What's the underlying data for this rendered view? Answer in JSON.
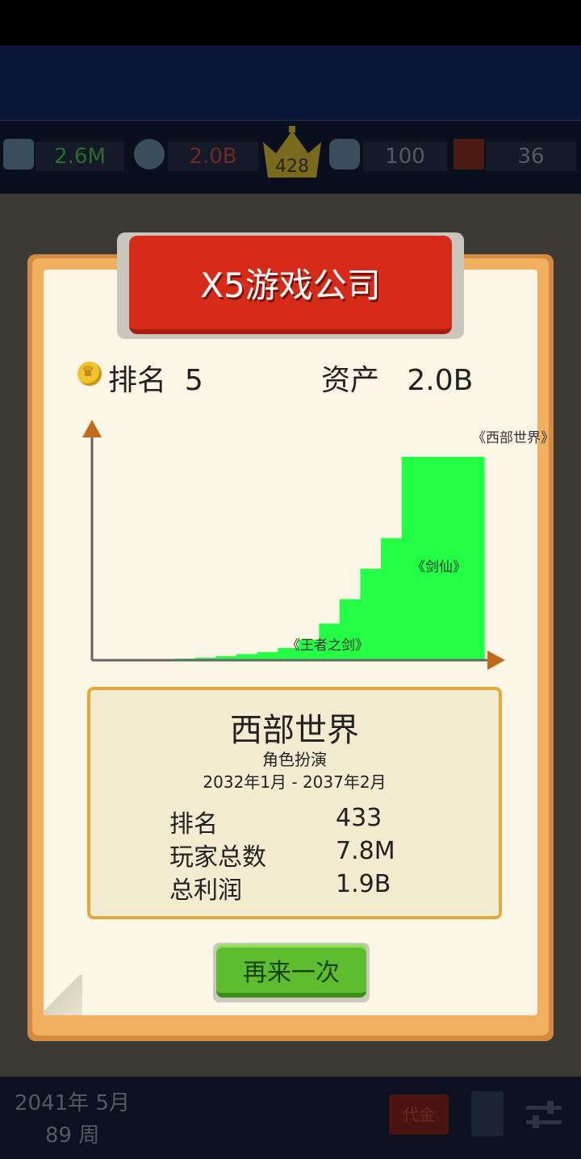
{
  "header_stats": {
    "fans": "2.6M",
    "money": "2.0B",
    "crown_rank": "428",
    "staff": "100",
    "slot": "36"
  },
  "dialog": {
    "title": "X5游戏公司",
    "rank_label": "排名",
    "rank_value": "5",
    "assets_label": "资产",
    "assets_value": "2.0B"
  },
  "chart_data": {
    "type": "area",
    "title": "",
    "xlabel": "",
    "ylabel": "",
    "annotations": [
      "《王者之剑》",
      "《剑仙》",
      "《西部世界》"
    ],
    "series": [
      {
        "values": [
          0.1,
          0.2,
          0.4,
          0.6,
          0.8,
          1.2,
          2,
          3,
          4,
          6,
          10,
          18,
          30,
          45,
          60,
          100,
          100,
          100,
          100
        ]
      }
    ],
    "colors": {
      "fill": "#22ff44",
      "axis": "#666666",
      "arrow": "#c06a1e"
    }
  },
  "info": {
    "name": "西部世界",
    "genre": "角色扮演",
    "period": "2032年1月 - 2037年2月",
    "rows": [
      {
        "label": "排名",
        "value": "433"
      },
      {
        "label": "玩家总数",
        "value": "7.8M"
      },
      {
        "label": "总利润",
        "value": "1.9B"
      }
    ]
  },
  "button": {
    "label": "再来一次"
  },
  "footer": {
    "date": "2041年 5月",
    "week": "89 周",
    "badge": "代金"
  }
}
